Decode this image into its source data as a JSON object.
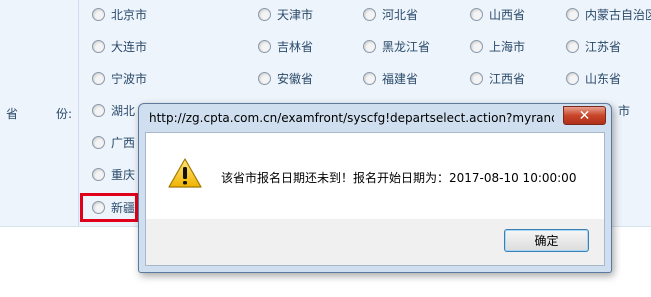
{
  "form": {
    "province_label_a": "省",
    "province_label_b": "份:",
    "provinces": [
      "北京市",
      "天津市",
      "河北省",
      "山西省",
      "内蒙古自治区",
      "大连市",
      "吉林省",
      "黑龙江省",
      "上海市",
      "江苏省",
      "宁波市",
      "安徽省",
      "福建省",
      "江西省",
      "山东省",
      "湖北",
      "",
      "",
      "",
      "市",
      "广西",
      "",
      "",
      "",
      "",
      "重庆",
      "",
      "",
      "",
      "",
      "新疆"
    ]
  },
  "dialog": {
    "title": "http://zg.cpta.com.cn/examfront/syscfg!departselect.action?myrand...",
    "close_glyph": "✕",
    "message": "该省市报名日期还未到！报名开始日期为：2017-08-10 10:00:00",
    "ok_label": "确定"
  }
}
